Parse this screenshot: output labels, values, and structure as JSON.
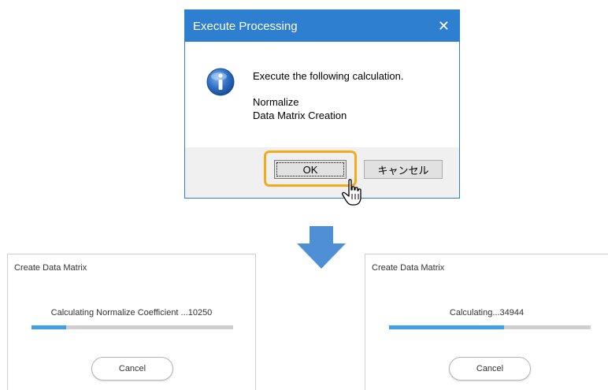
{
  "dialog": {
    "title": "Execute Processing",
    "close_glyph": "✕",
    "message": "Execute the following calculation.",
    "lines": [
      "Normalize",
      "Data Matrix Creation"
    ],
    "ok_label": "OK",
    "cancel_label": "キャンセル",
    "colors": {
      "titlebar": "#2f7fd0",
      "highlight": "#f3ab1c"
    },
    "icons": {
      "info": "info-icon",
      "cursor": "hand-cursor-icon",
      "close": "close-icon"
    }
  },
  "arrow_icon": "down-arrow-icon",
  "panels": [
    {
      "title": "Create Data Matrix",
      "status": "Calculating Normalize Coefficient ...10250",
      "progress": 0.17,
      "cancel_label": "Cancel"
    },
    {
      "title": "Create Data Matrix",
      "status": "Calculating...34944",
      "progress": 0.57,
      "cancel_label": "Cancel"
    }
  ],
  "colors": {
    "progress_fill": "#3ea0e6",
    "progress_track": "#cfcfcf"
  }
}
